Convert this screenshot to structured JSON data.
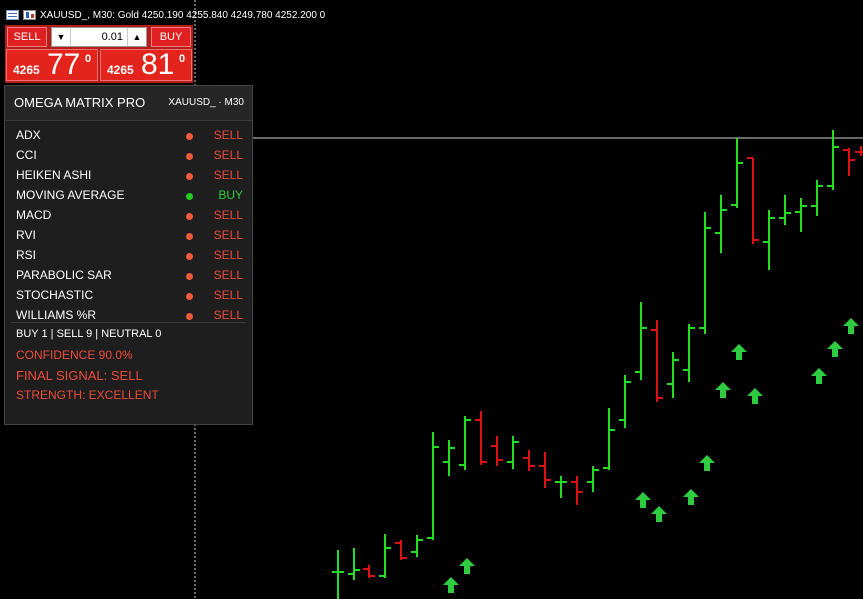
{
  "header": {
    "symbol_line": "XAUUSD_, M30:  Gold  4250.190 4255.840 4249.780 4252.200  0"
  },
  "trade_panel": {
    "sell_label": "SELL",
    "buy_label": "BUY",
    "lot_value": "0.01",
    "lot_down_icon": "triangle-down-icon",
    "lot_up_icon": "triangle-up-icon",
    "bid": {
      "prefix": "4265",
      "big": "77",
      "sup": "0"
    },
    "ask": {
      "prefix": "4265",
      "big": "81",
      "sup": "0"
    }
  },
  "indicator_panel": {
    "title": "OMEGA MATRIX PRO",
    "symbol": "XAUUSD_ · M30",
    "rows": [
      {
        "name": "ADX",
        "signal": "SELL"
      },
      {
        "name": "CCI",
        "signal": "SELL"
      },
      {
        "name": "HEIKEN ASHI",
        "signal": "SELL"
      },
      {
        "name": "MOVING AVERAGE",
        "signal": "BUY"
      },
      {
        "name": "MACD",
        "signal": "SELL"
      },
      {
        "name": "RVI",
        "signal": "SELL"
      },
      {
        "name": "RSI",
        "signal": "SELL"
      },
      {
        "name": "PARABOLIC SAR",
        "signal": "SELL"
      },
      {
        "name": "STOCHASTIC",
        "signal": "SELL"
      },
      {
        "name": "WILLIAMS %R",
        "signal": "SELL"
      }
    ],
    "tally": "BUY 1  |  SELL 9  |  NEUTRAL 0",
    "confidence": "CONFIDENCE 90.0%",
    "final_signal": "FINAL SIGNAL: SELL",
    "strength": "STRENGTH: EXCELLENT"
  },
  "colors": {
    "background": "#000000",
    "bull": "#22dd22",
    "bear": "#dd1111",
    "arrow": "#2ecc40",
    "sell_text": "#ee4a3a",
    "buy_text": "#2ecc40",
    "sell_dot": "#ee5a3a",
    "buy_dot": "#22cc22",
    "trade_red": "#e3241d"
  }
}
